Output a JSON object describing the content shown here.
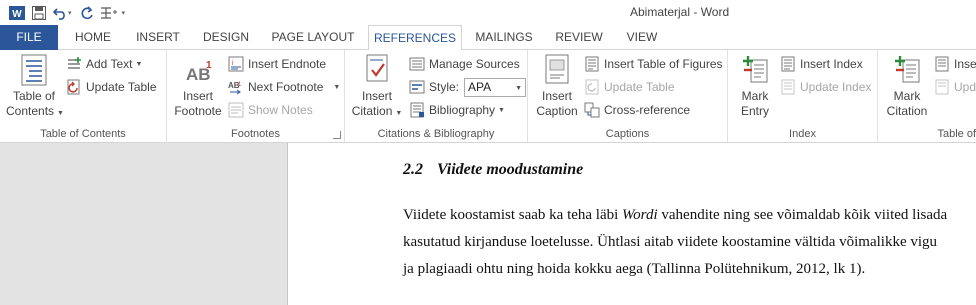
{
  "window": {
    "title": "Abimaterjal - Word"
  },
  "qat": {
    "undo_caret": "▾",
    "customize": "▾"
  },
  "tabs": [
    "FILE",
    "HOME",
    "INSERT",
    "DESIGN",
    "PAGE LAYOUT",
    "REFERENCES",
    "MAILINGS",
    "REVIEW",
    "VIEW"
  ],
  "active_tab": "REFERENCES",
  "colors": {
    "file_tab": "#2b579a",
    "accent": "#2b579a",
    "word_blue": "#2b579a",
    "disabled": "#a6a6a6",
    "doc_bg": "#e3e3e3"
  },
  "ribbon": {
    "toc": {
      "group_label": "Table of Contents",
      "toc_button_line1": "Table of",
      "toc_button_line2": "Contents",
      "add_text": "Add Text",
      "update_table": "Update Table"
    },
    "footnotes": {
      "group_label": "Footnotes",
      "insert_footnote_line1": "Insert",
      "insert_footnote_line2": "Footnote",
      "insert_endnote": "Insert Endnote",
      "next_footnote": "Next Footnote",
      "show_notes": "Show Notes"
    },
    "citations": {
      "group_label": "Citations & Bibliography",
      "insert_citation_line1": "Insert",
      "insert_citation_line2": "Citation",
      "manage_sources": "Manage Sources",
      "style_label": "Style:",
      "style_value": "APA",
      "bibliography": "Bibliography"
    },
    "captions": {
      "group_label": "Captions",
      "insert_caption_line1": "Insert",
      "insert_caption_line2": "Caption",
      "insert_table_of_figures": "Insert Table of Figures",
      "update_table": "Update Table",
      "cross_reference": "Cross-reference"
    },
    "index": {
      "group_label": "Index",
      "mark_entry_line1": "Mark",
      "mark_entry_line2": "Entry",
      "insert_index": "Insert Index",
      "update_index": "Update Index"
    },
    "table_of_authorities": {
      "group_label": "Table of",
      "mark_citation_line1": "Mark",
      "mark_citation_line2": "Citation",
      "insert": "Inser",
      "update": "Upd"
    }
  },
  "document": {
    "heading_number": "2.2",
    "heading_text": "Viidete moodustamine",
    "line1_before": "Viidete koostamist saab ka teha läbi ",
    "line1_italic": "Wordi",
    "line1_after": " vahendite ning see võimaldab kõik viited lisada",
    "line2": "kasutatud kirjanduse loetelusse. Ühtlasi aitab viidete koostamine vältida võimalikke vigu",
    "line3": "ja plagiaadi ohtu ning hoida kokku aega (Tallinna Polütehnikum, 2012, lk 1)."
  }
}
